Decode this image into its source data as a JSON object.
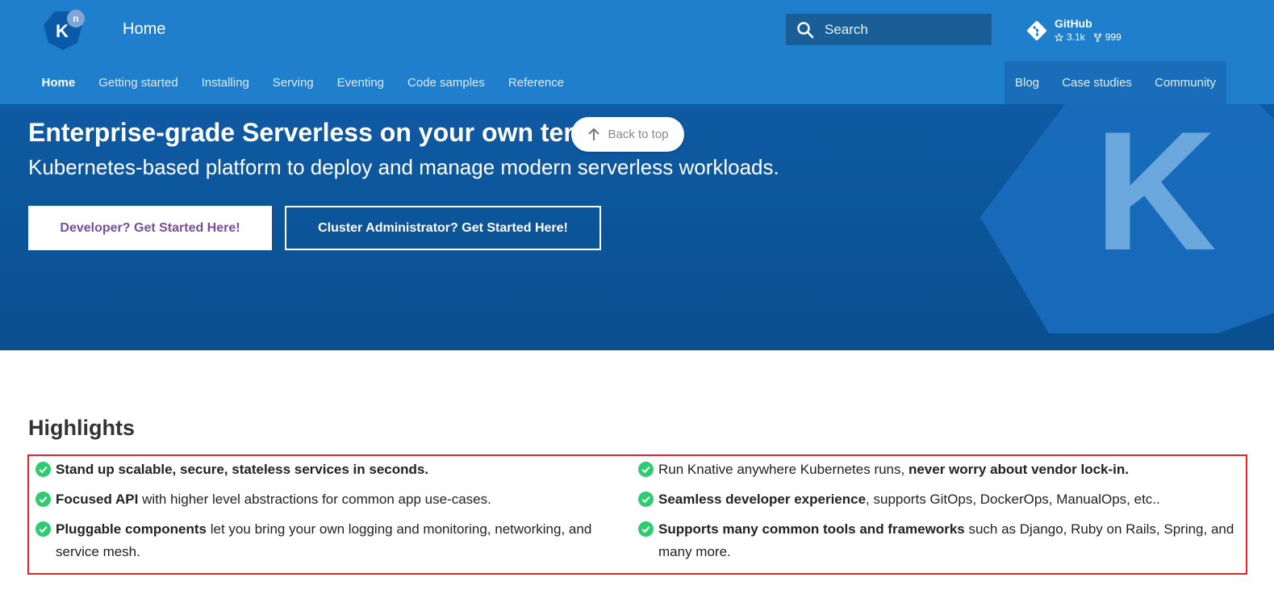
{
  "header": {
    "site_title": "Home",
    "search_placeholder": "Search",
    "github": {
      "name": "GitHub",
      "stars": "3.1k",
      "forks": "999"
    },
    "logo_letter": "K",
    "logo_badge": "n"
  },
  "nav": {
    "items": [
      "Home",
      "Getting started",
      "Installing",
      "Serving",
      "Eventing",
      "Code samples",
      "Reference"
    ],
    "right_items": [
      "Blog",
      "Case studies",
      "Community"
    ]
  },
  "hero": {
    "title": "Enterprise-grade Serverless on your own terms.",
    "subtitle": "Kubernetes-based platform to deploy and manage modern serverless workloads.",
    "dev_button": "Developer? Get Started Here!",
    "admin_button": "Cluster Administrator? Get Started Here!",
    "bg_letter": "K"
  },
  "back_to_top": "Back to top",
  "highlights": {
    "title": "Highlights",
    "items": [
      {
        "bold": "Stand up scalable, secure, stateless services in seconds.",
        "text": ""
      },
      {
        "bold": "Focused API",
        "text": " with higher level abstractions for common app use-cases."
      },
      {
        "bold": "Pluggable components",
        "text": " let you bring your own logging and monitoring, networking, and service mesh."
      },
      {
        "pre": "Run Knative anywhere Kubernetes runs, ",
        "bold": "never worry about vendor lock-in.",
        "text": ""
      },
      {
        "bold": "Seamless developer experience",
        "text": ", supports GitOps, DockerOps, ManualOps, etc.."
      },
      {
        "bold": "Supports many common tools and frameworks",
        "text": " such as Django, Ruby on Rails, Spring, and many more."
      }
    ]
  },
  "colors": {
    "header": "#1f7fcd",
    "hero": "#0e5aa3",
    "check": "#2ecc71",
    "highlight_border": "#e8212a",
    "dev_button_text": "#7a4d9b"
  }
}
